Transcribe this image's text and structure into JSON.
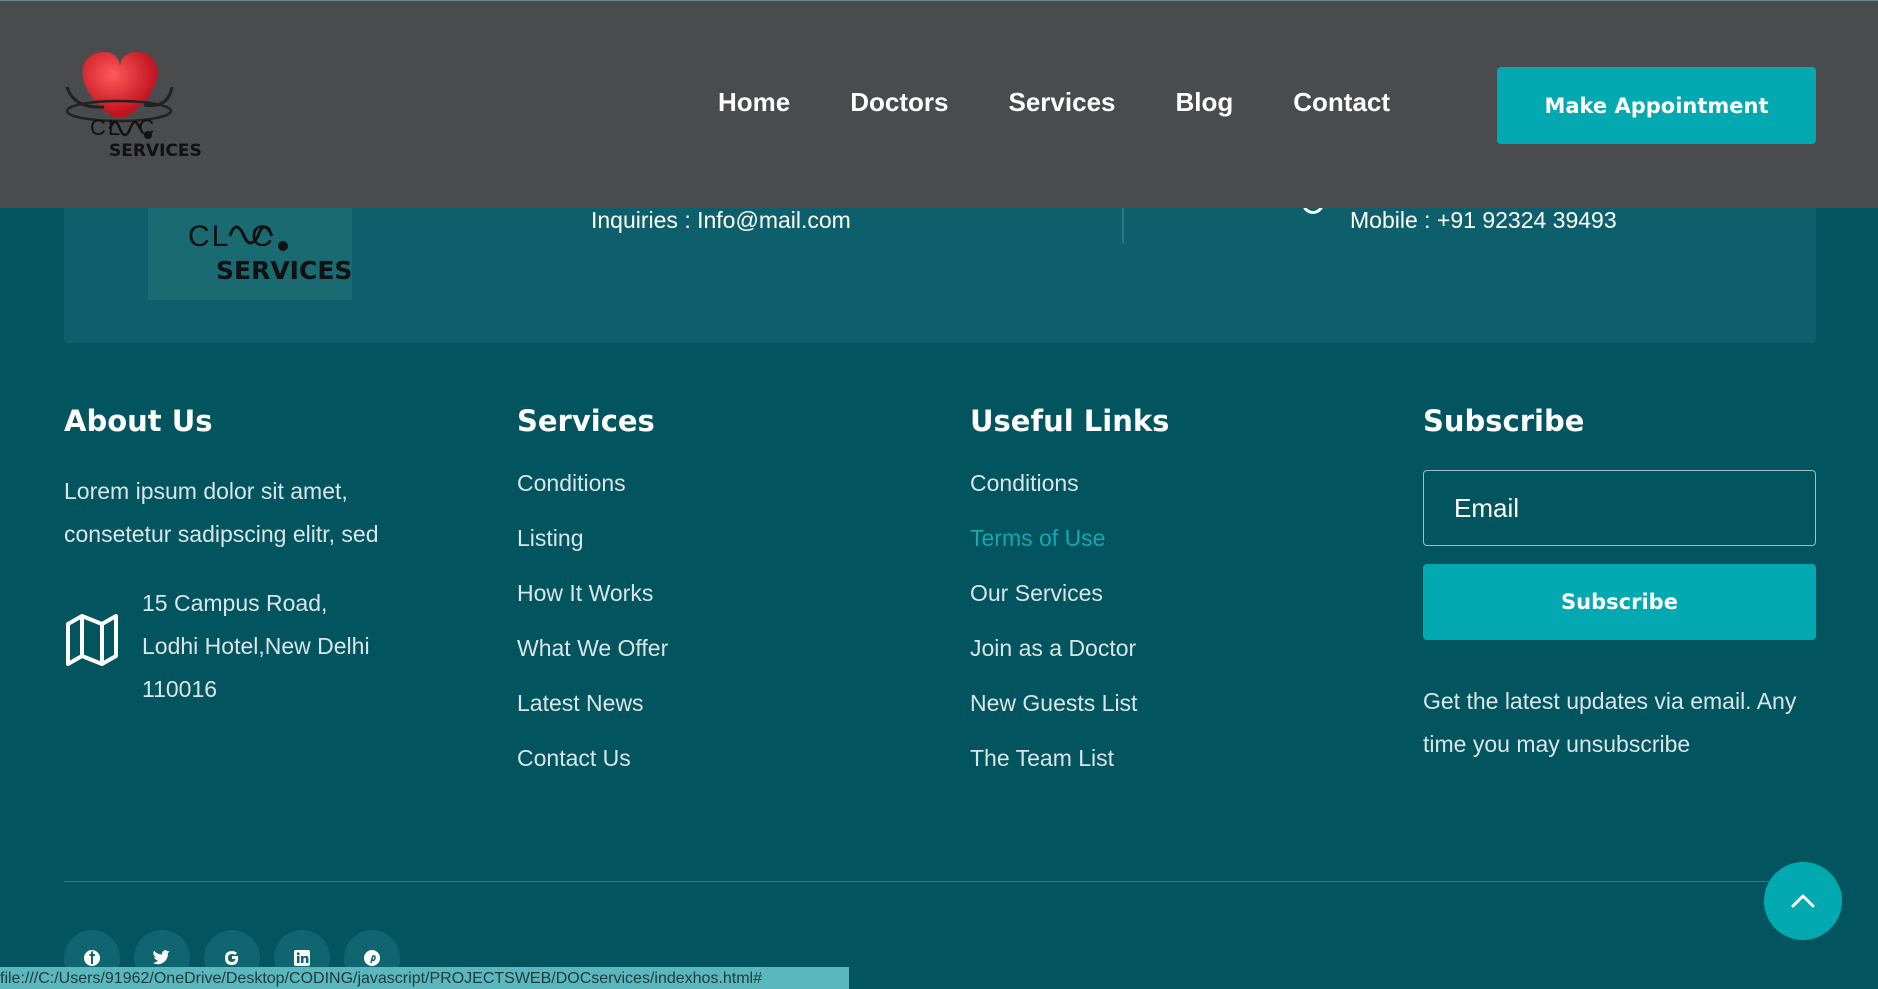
{
  "brand": {
    "clinic": "CL  C",
    "services": "SERVICES"
  },
  "nav": {
    "items": [
      "Home",
      "Doctors",
      "Services",
      "Blog",
      "Contact"
    ],
    "appointment_label": "Make Appointment"
  },
  "info": {
    "inquiries": "Inquiries : Info@mail.com",
    "mobile": "Mobile : +91 92324 39493"
  },
  "about": {
    "title": "About Us",
    "text": "Lorem ipsum dolor sit amet, consetetur sadipscing elitr, sed",
    "address_lines": [
      "15 Campus Road,",
      "Lodhi Hotel,New Delhi",
      "110016"
    ]
  },
  "services": {
    "title": "Services",
    "items": [
      "Conditions",
      "Listing",
      "How It Works",
      "What We Offer",
      "Latest News",
      "Contact Us"
    ]
  },
  "useful_links": {
    "title": "Useful Links",
    "items": [
      "Conditions",
      "Terms of Use",
      "Our Services",
      "Join as a Doctor",
      "New Guests List",
      "The Team List"
    ],
    "active_index": 1
  },
  "subscribe": {
    "title": "Subscribe",
    "email_placeholder": "Email",
    "button_label": "Subscribe",
    "note": "Get the latest updates via email. Any time you may unsubscribe"
  },
  "socials": [
    "facebook-icon",
    "twitter-icon",
    "google-icon",
    "linkedin-icon",
    "pinterest-icon"
  ],
  "status_bar": {
    "url": "file:///C:/Users/91962/OneDrive/Desktop/CODING/javascript/PROJECTSWEB/DOCservices/indexhos.html#"
  },
  "colors": {
    "accent": "#03a9b0",
    "header_bg": "#4a4b4d",
    "footer_bg": "#02545f",
    "link_active": "#1aa6b0"
  }
}
